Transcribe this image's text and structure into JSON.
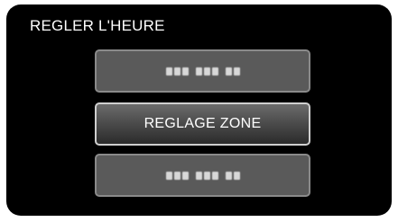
{
  "window": {
    "title": "REGLER L'HEURE"
  },
  "menu": {
    "items": [
      {
        "label": ""
      },
      {
        "label": "REGLAGE ZONE"
      },
      {
        "label": ""
      }
    ]
  }
}
